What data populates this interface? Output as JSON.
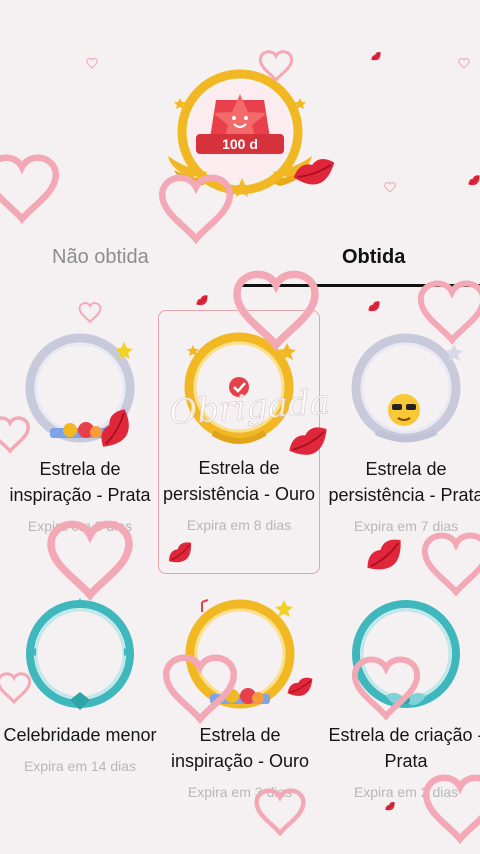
{
  "hero": {
    "badge_text": "100 d"
  },
  "tabs": {
    "not_obtained": "Não obtida",
    "obtained": "Obtida"
  },
  "cards": [
    {
      "name": "Estrela de inspiração - Prata",
      "expiry": "Expira em 8 dias"
    },
    {
      "name": "Estrela de persistência - Ouro",
      "expiry": "Expira em 8 dias"
    },
    {
      "name": "Estrela de persistência - Prata",
      "expiry": "Expira em 7 dias"
    },
    {
      "name": "Celebridade menor",
      "expiry": "Expira em 14 dias"
    },
    {
      "name": "Estrela de inspiração - Ouro",
      "expiry": "Expira em 3 dias"
    },
    {
      "name": "Estrela de criação - Prata",
      "expiry": "Expira em 2 dias"
    }
  ],
  "watermark": "Obrigada",
  "colors": {
    "accent": "#e8404a",
    "gold": "#f2b824",
    "silver": "#c9c9dc",
    "teal": "#3fb8bd",
    "text": "#151515",
    "muted": "#b7b7b7"
  }
}
